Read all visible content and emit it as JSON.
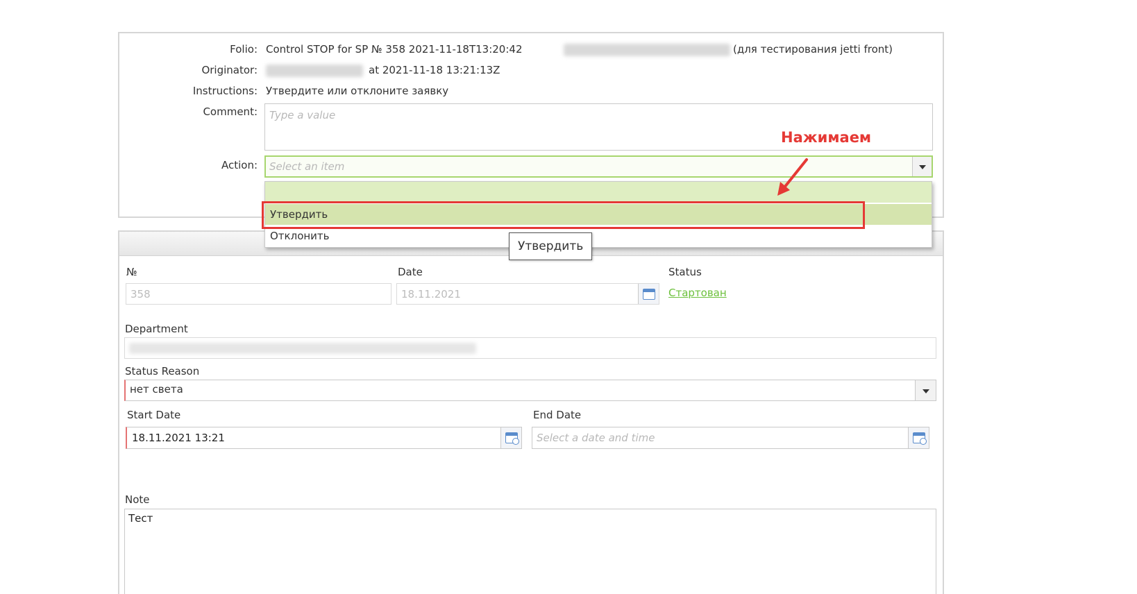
{
  "task": {
    "folio_label": "Folio:",
    "folio_text": "Control STOP for SP № 358 2021-11-18T13:20:42",
    "folio_suffix": "(для тестирования jetti front)",
    "originator_label": "Originator:",
    "originator_at": "at  2021-11-18 13:21:13Z",
    "instructions_label": "Instructions:",
    "instructions_text": "Утвердите или отклоните заявку",
    "comment_label": "Comment:",
    "comment_placeholder": "Type a value",
    "action_label": "Action:",
    "action_placeholder": "Select an item",
    "action_options": [
      "Утвердить",
      "Отклонить"
    ],
    "tooltip": "Утвердить",
    "annotation": "Нажимаем"
  },
  "form": {
    "number_label": "№",
    "number_value": "358",
    "date_label": "Date",
    "date_value": "18.11.2021",
    "status_label": "Status",
    "status_value": "Стартован",
    "department_label": "Department",
    "status_reason_label": "Status Reason",
    "status_reason_value": "нет света",
    "start_date_label": "Start Date",
    "start_date_value": "18.11.2021 13:21",
    "end_date_label": "End Date",
    "end_date_placeholder": "Select a date and time",
    "note_label": "Note",
    "note_value": "Тест"
  },
  "colors": {
    "annotation_red": "#e53935",
    "highlight_green": "#d5e4ae",
    "status_link": "#6cc03c"
  }
}
